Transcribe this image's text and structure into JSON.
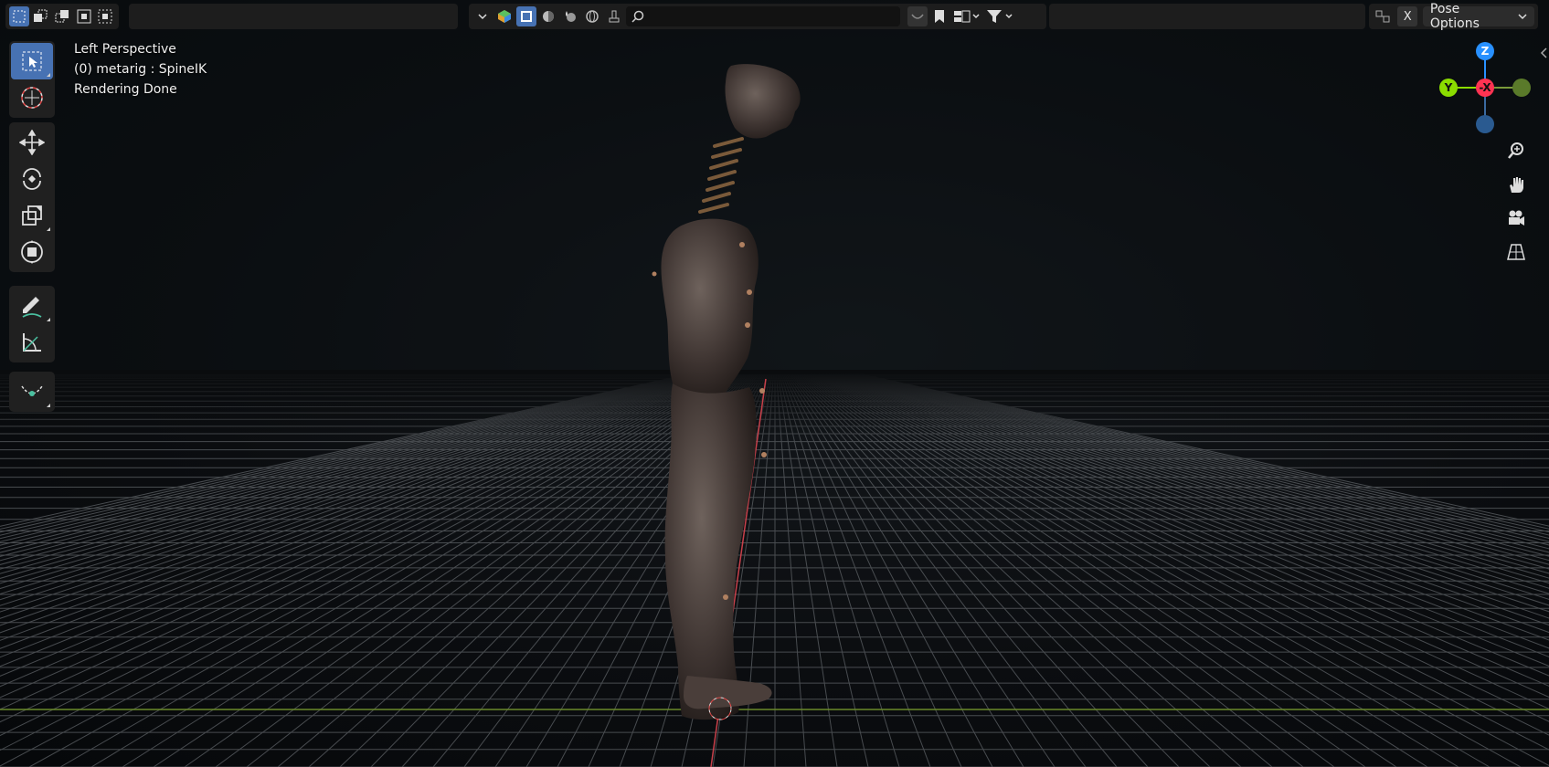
{
  "viewport": {
    "view_name": "Left Perspective",
    "active_object": "(0) metarig : SpineIK",
    "status": "Rendering Done"
  },
  "header": {
    "center_tools": [
      "view-dropdown-icon",
      "solid-shading-icon",
      "object-mode-icon",
      "material-preview-icon",
      "render-preview-icon",
      "world-icon",
      "gizmo-icon"
    ],
    "search": {
      "placeholder": ""
    },
    "right_close_label": "X",
    "pose_options_label": "Pose Options"
  },
  "gizmo": {
    "axis_z": "Z",
    "axis_y": "Y",
    "axis_x": "-X",
    "colors": {
      "x": "#ff3352",
      "y": "#8bdc00",
      "z": "#2890ff"
    }
  },
  "colors": {
    "accent": "#4772b3",
    "grid": "#5a5e62",
    "x_axis_line": "#c8404a",
    "y_axis_line": "#6a8a2a"
  }
}
